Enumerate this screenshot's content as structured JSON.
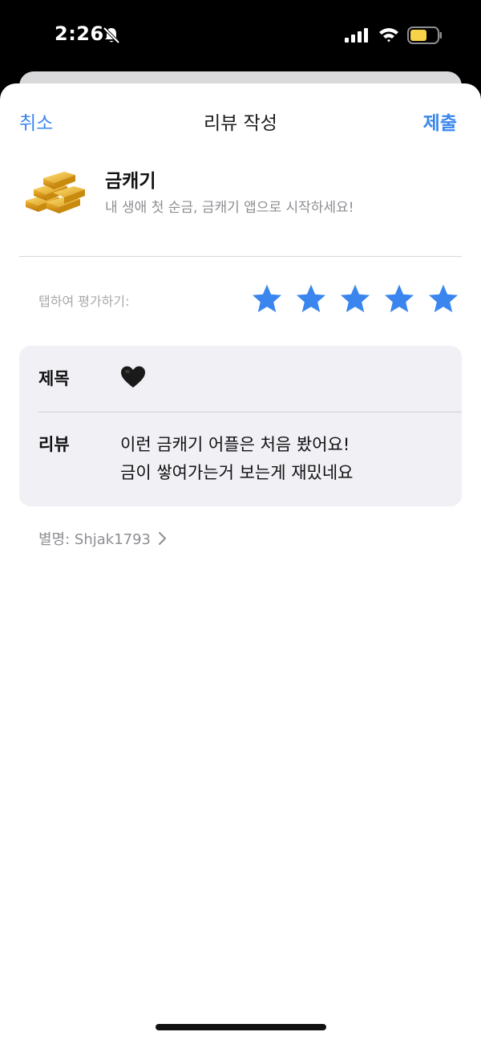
{
  "status_bar": {
    "time": "2:26",
    "icons": [
      "bell-slash-icon",
      "signal-icon",
      "wifi-icon",
      "battery-icon"
    ],
    "battery_color": "#f7d34a"
  },
  "nav": {
    "cancel_label": "취소",
    "title": "리뷰 작성",
    "submit_label": "제출"
  },
  "app": {
    "icon": "gold-bars-icon",
    "name": "금캐기",
    "subtitle": "내 생애 첫 순금, 금캐기 앱으로 시작하세요!"
  },
  "rating": {
    "label": "탭하여 평가하기:",
    "stars_selected": 5,
    "stars_total": 5,
    "star_color": "#3a86ee"
  },
  "form": {
    "title_label": "제목",
    "title_value": "🖤",
    "title_icon": "black-heart-icon",
    "review_label": "리뷰",
    "review_lines": [
      "이런 금캐기 어플은 처음 봤어요!",
      "금이 쌓여가는거 보는게 재밌네요"
    ]
  },
  "nickname": {
    "text": "별명: Shjak1793",
    "icon": "chevron-right-icon"
  },
  "colors": {
    "accent": "#3a86ee",
    "background": "#ffffff",
    "card": "#f0f0f5"
  }
}
